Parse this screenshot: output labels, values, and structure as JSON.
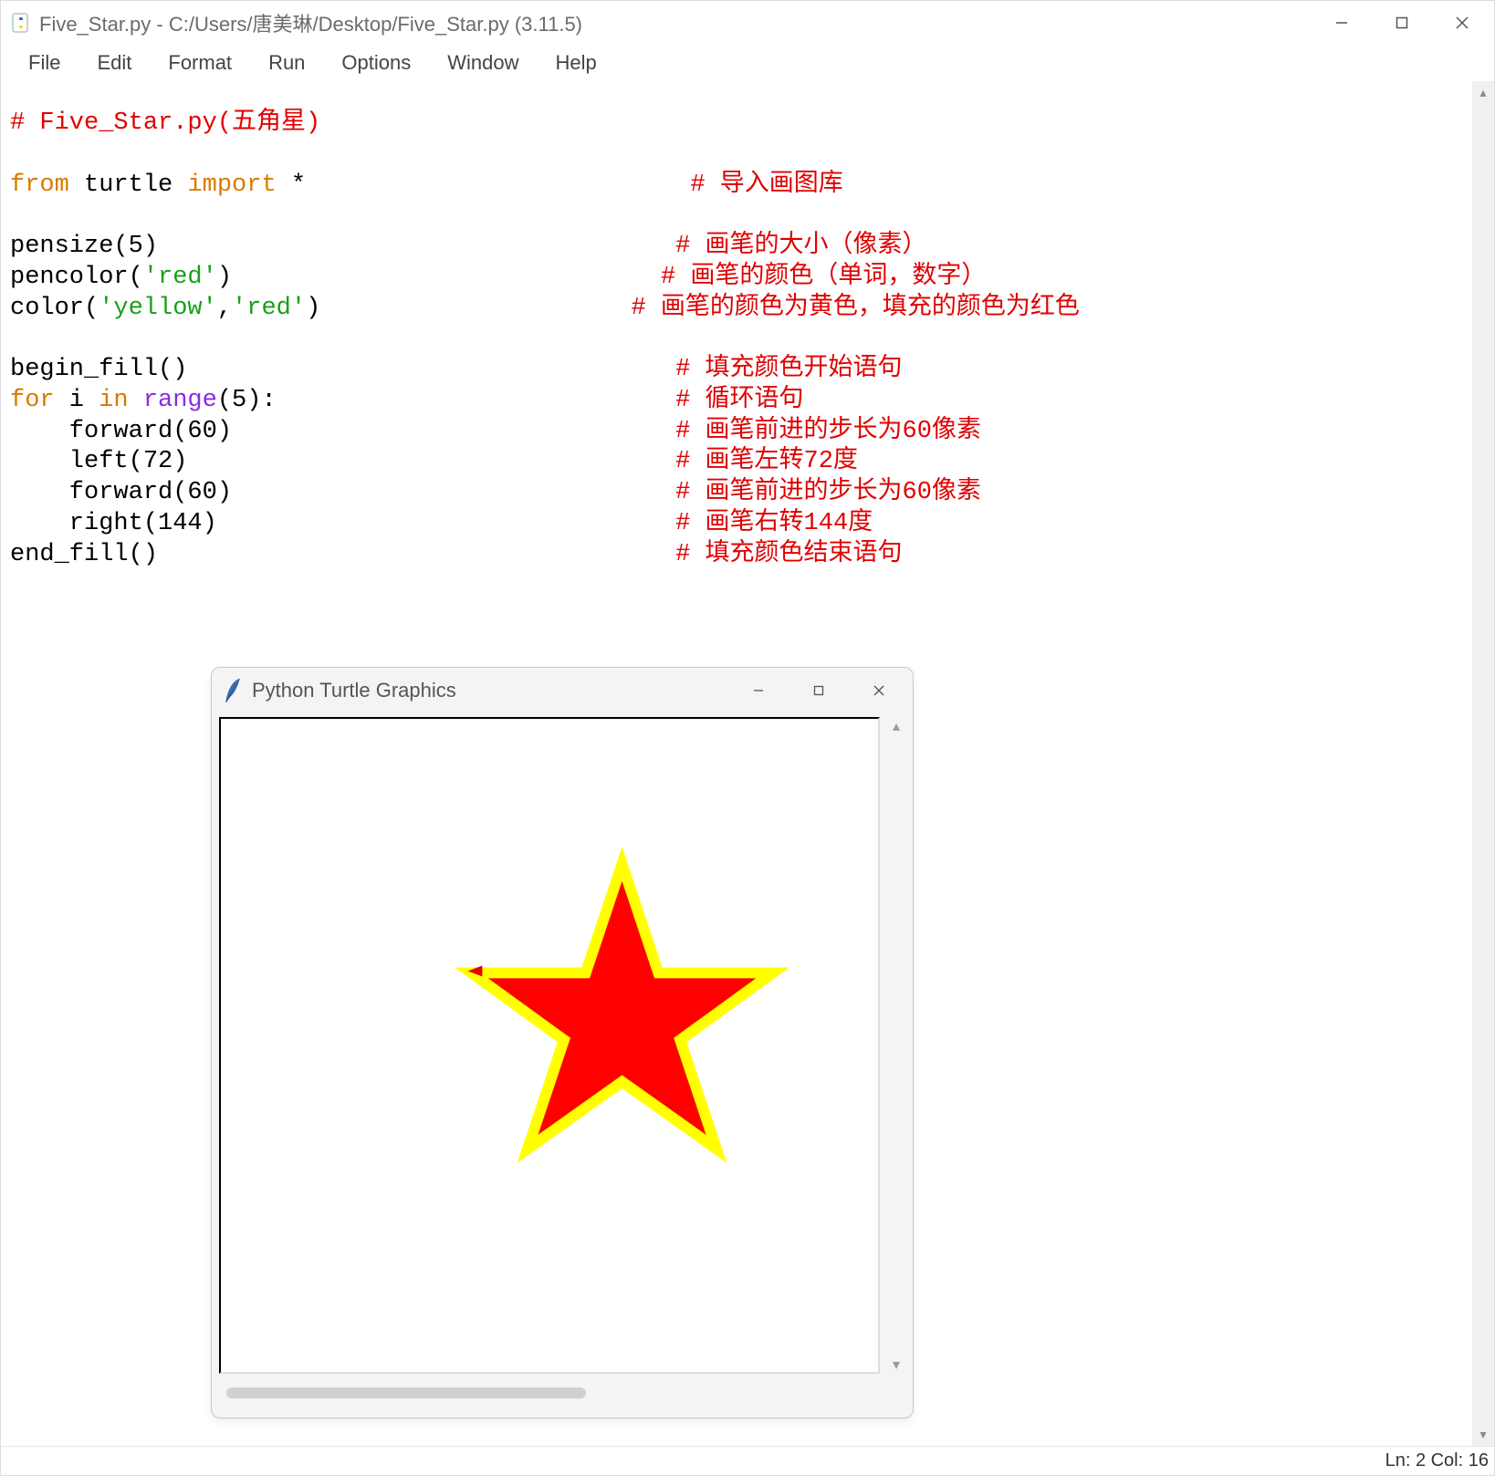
{
  "idle": {
    "title": "Five_Star.py - C:/Users/唐美琳/Desktop/Five_Star.py (3.11.5)",
    "menu": [
      "File",
      "Edit",
      "Format",
      "Run",
      "Options",
      "Window",
      "Help"
    ],
    "status": "Ln: 2  Col: 16"
  },
  "code": {
    "l1_comment": "# Five_Star.py(五角星)",
    "l3_from": "from",
    "l3_mod": " turtle ",
    "l3_import": "import",
    "l3_star": " *",
    "l3_cm": "# 导入画图库",
    "l5": "pensize(5)",
    "l5_cm": "# 画笔的大小（像素）",
    "l6a": "pencolor(",
    "l6s": "'red'",
    "l6b": ")",
    "l6_cm": "# 画笔的颜色（单词，数字）",
    "l7a": "color(",
    "l7s1": "'yellow'",
    "l7c": ",",
    "l7s2": "'red'",
    "l7b": ")",
    "l7_cm": "# 画笔的颜色为黄色，填充的颜色为红色",
    "l9": "begin_fill()",
    "l9_cm": "# 填充颜色开始语句",
    "l10_for": "for",
    "l10_i": " i ",
    "l10_in": "in",
    "l10_sp": " ",
    "l10_range": "range",
    "l10_tail": "(5):",
    "l10_cm": "# 循环语句",
    "l11": "    forward(60)",
    "l11_cm": "# 画笔前进的步长为60像素",
    "l12": "    left(72)",
    "l12_cm": "# 画笔左转72度",
    "l13": "    forward(60)",
    "l13_cm": "# 画笔前进的步长为60像素",
    "l14": "    right(144)",
    "l14_cm": "# 画笔右转144度",
    "l15": "end_fill()",
    "l15_cm": "# 填充颜色结束语句",
    "pad3": "                          ",
    "pad5": "                                   ",
    "pad6": "                             ",
    "pad7": "                     ",
    "pad9": "                                 ",
    "pad10": "                           ",
    "pad11": "                              ",
    "pad12": "                                 ",
    "pad13": "                              ",
    "pad14": "                               ",
    "pad15": "                                   "
  },
  "turtle": {
    "title": "Python Turtle Graphics",
    "star": {
      "fill": "red",
      "outline": "yellow",
      "pensize": 5
    }
  }
}
